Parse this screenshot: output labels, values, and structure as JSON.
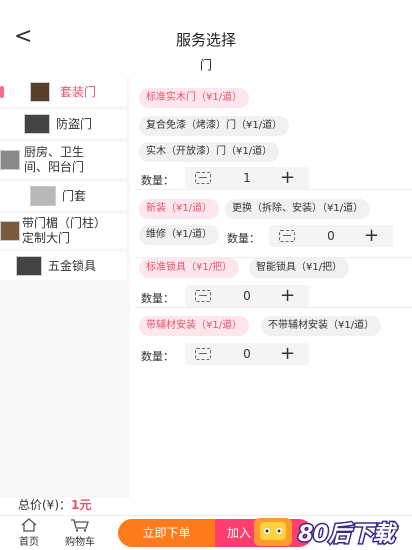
{
  "header": {
    "back_glyph": "<",
    "title": "服务选择",
    "subtitle": "门"
  },
  "sidebar": {
    "items": [
      {
        "label": "套装门",
        "thumb": "brown"
      },
      {
        "label": "防盗门",
        "thumb": "dark"
      },
      {
        "label": "厨房、卫生间、阳台门",
        "thumb": "grey"
      },
      {
        "label": "门套",
        "thumb": "grey"
      },
      {
        "label": "带门楣（门柱）定制大门",
        "thumb": "brown"
      },
      {
        "label": "五金锁具",
        "thumb": "dark"
      }
    ],
    "active_index": 0
  },
  "sections": [
    {
      "tags": [
        "标准实木门（¥1/道）",
        "复合免漆（烤漆）门（¥1/道）",
        "实木（开放漆）门（¥1/道）"
      ],
      "selected_tag": 0,
      "qty_label": "数量：",
      "qty": "1"
    },
    {
      "tags": [
        "新装（¥1/道）",
        "更换（拆除、安装）（¥1/道）",
        "维修（¥1/道）"
      ],
      "selected_tag": 0,
      "qty_label": "数量：",
      "qty": "0"
    },
    {
      "tags": [
        "标准锁具（¥1/把）",
        "智能锁具（¥1/把）"
      ],
      "selected_tag": 0,
      "qty_label": "数量：",
      "qty": "0"
    },
    {
      "tags": [
        "带辅材安装（¥1/道）",
        "不带辅材安装（¥1/道）"
      ],
      "selected_tag": 0,
      "qty_label": "数量：",
      "qty": "0"
    }
  ],
  "stepper": {
    "plus_glyph": "+"
  },
  "total": {
    "label": "总价(¥)：",
    "price": "1元"
  },
  "bottom_nav": {
    "home_label": "首页",
    "cart_label": "购物车",
    "order_button": "立即下单",
    "add_cart_button": "加入"
  },
  "watermark": {
    "text": "80后下载"
  },
  "colors": {
    "accent": "#e8536b",
    "orange": "#ff7a1a",
    "pink": "#ff3d6e"
  }
}
